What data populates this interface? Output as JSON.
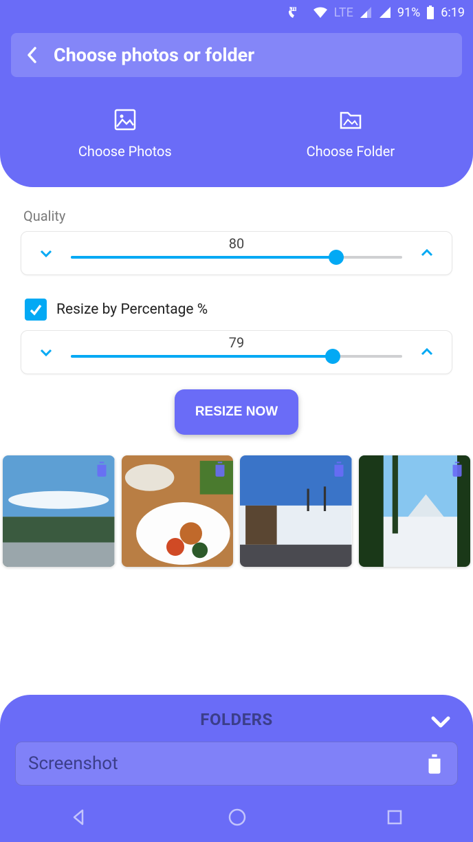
{
  "status": {
    "lte": "LTE",
    "battery": "91%",
    "time": "6:19"
  },
  "header": {
    "title": "Choose photos or folder",
    "choose_photos_label": "Choose Photos",
    "choose_folder_label": "Choose Folder"
  },
  "quality": {
    "label": "Quality",
    "value": "80",
    "percent": 80
  },
  "resize": {
    "checkbox_label": "Resize by Percentage %",
    "checked": true,
    "value": "79",
    "percent": 79
  },
  "resize_button": "RESIZE NOW",
  "thumbnails": [
    {
      "name": "landscape-sky",
      "del_color": "#6A6CF7"
    },
    {
      "name": "food-plate",
      "del_color": "#6A6CF7"
    },
    {
      "name": "snow-village",
      "del_color": "#6A6CF7"
    },
    {
      "name": "winter-mountain",
      "del_color": "#6A6CF7"
    }
  ],
  "folders": {
    "title": "FOLDERS",
    "items": [
      {
        "name": "Screenshot"
      }
    ]
  }
}
